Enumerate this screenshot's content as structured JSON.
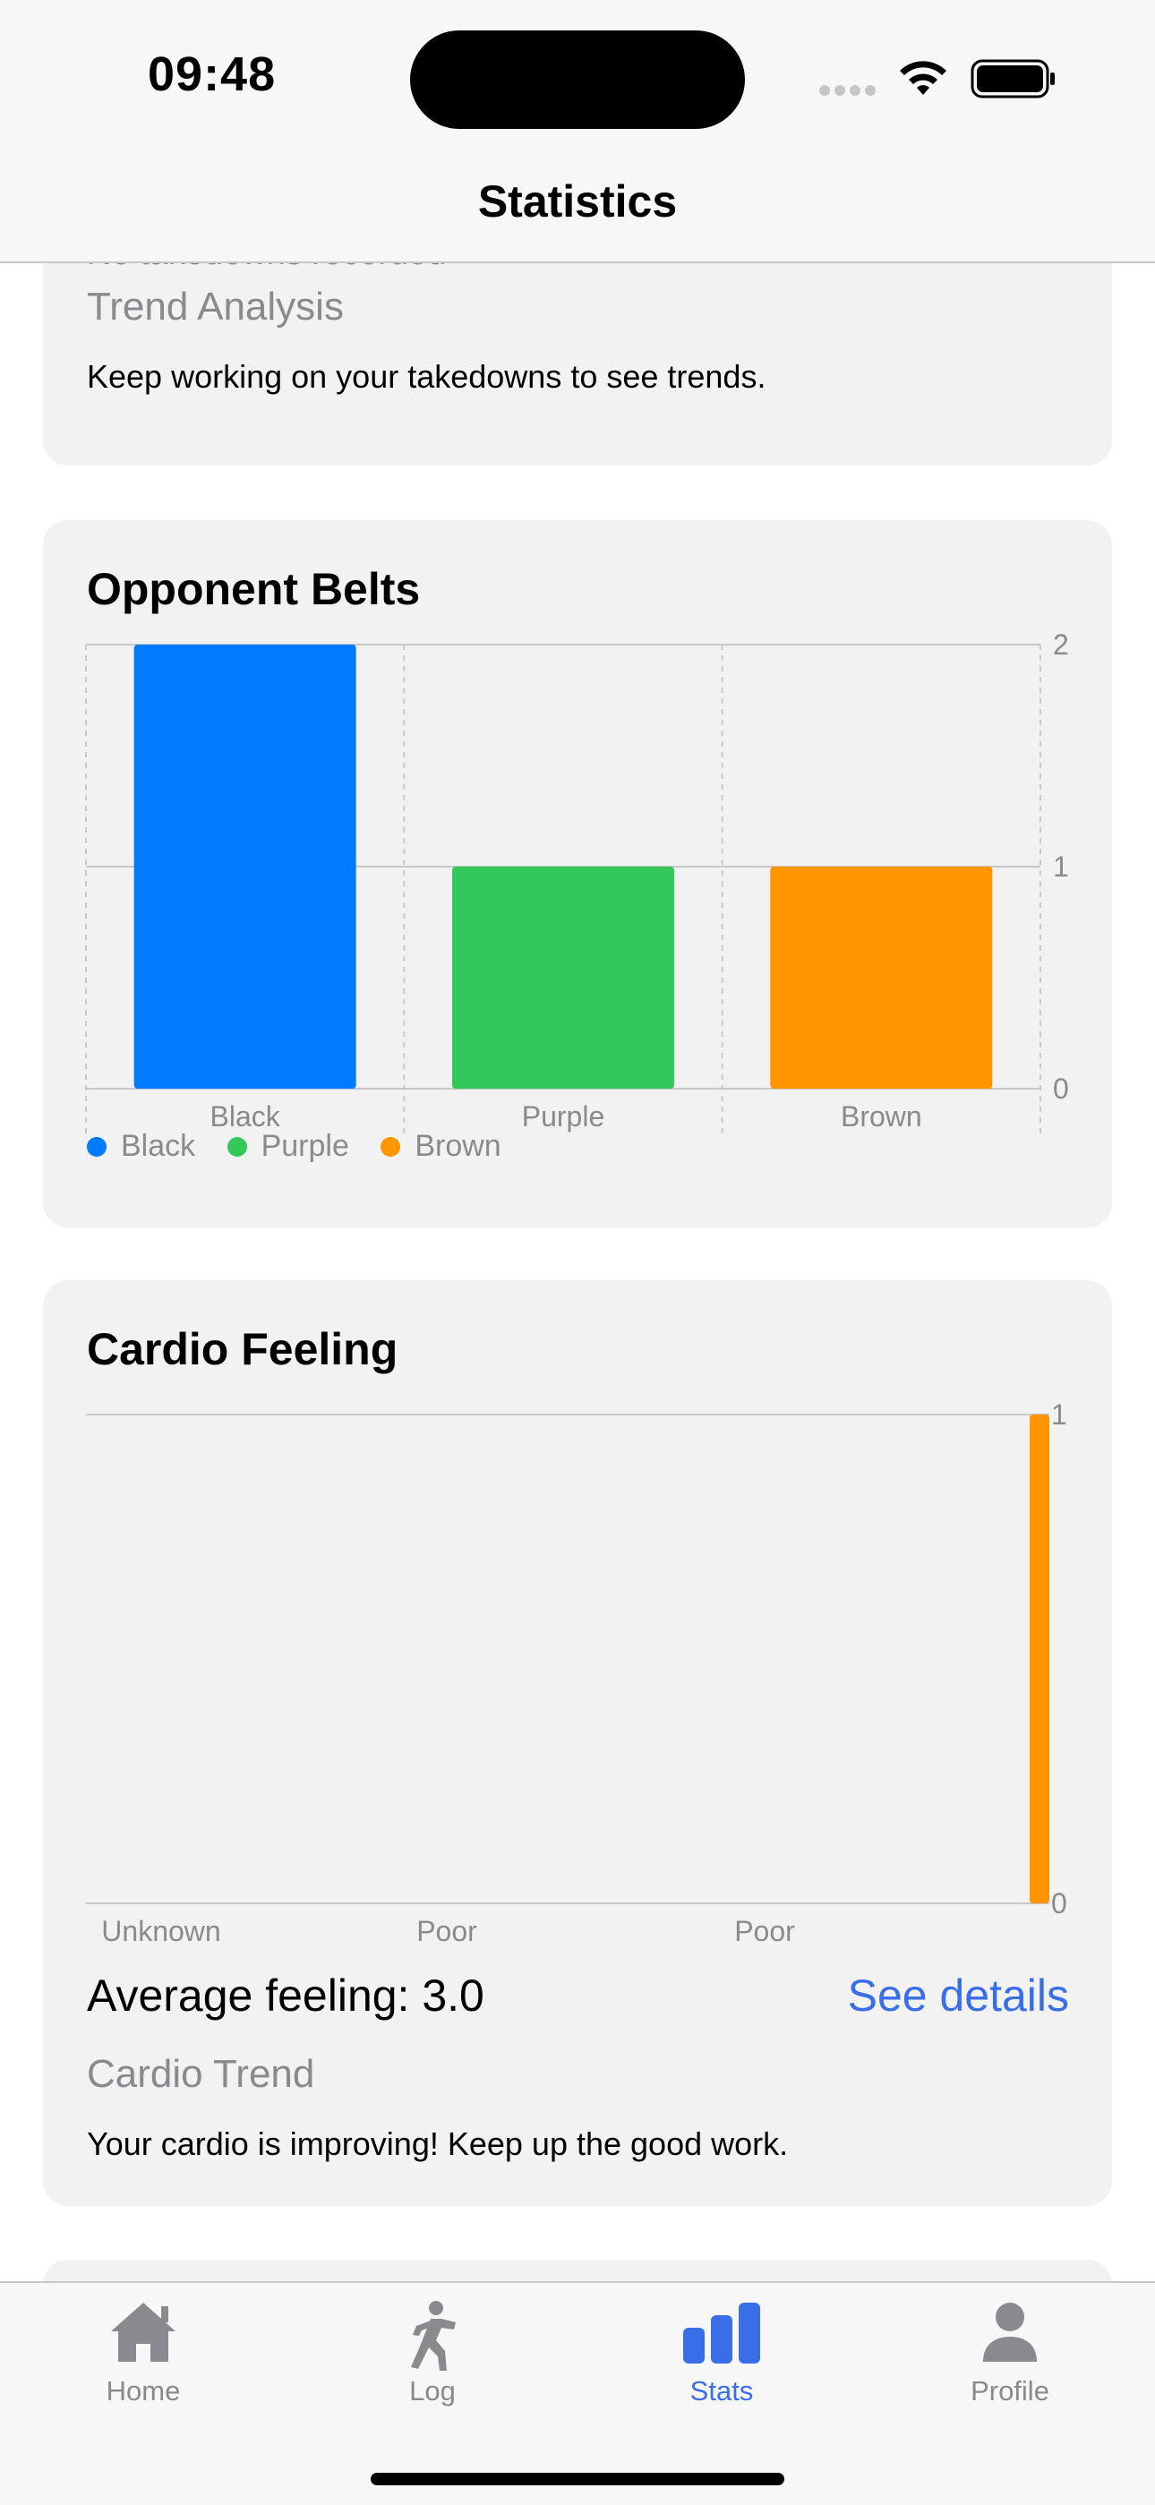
{
  "status_bar": {
    "time": "09:48"
  },
  "nav": {
    "title": "Statistics"
  },
  "takedowns_card": {
    "partial_text": "No takedowns recorded",
    "trend_heading": "Trend Analysis",
    "trend_text": "Keep working on your takedowns to see trends."
  },
  "belts_card": {
    "title": "Opponent Belts",
    "legend": [
      {
        "label": "Black",
        "color": "#007aff"
      },
      {
        "label": "Purple",
        "color": "#34c759"
      },
      {
        "label": "Brown",
        "color": "#ff9500"
      }
    ]
  },
  "cardio_card": {
    "title": "Cardio Feeling",
    "average": "Average feeling: 3.0",
    "see_details": "See details",
    "trend_heading": "Cardio Trend",
    "trend_text": "Your cardio is improving! Keep up the good work."
  },
  "chart_data": [
    {
      "type": "bar",
      "title": "Opponent Belts",
      "categories": [
        "Black",
        "Purple",
        "Brown"
      ],
      "values": [
        2,
        1,
        1
      ],
      "colors": [
        "#007aff",
        "#34c759",
        "#ff9500"
      ],
      "y_ticks": [
        "2",
        "1",
        "0"
      ],
      "ylim": [
        0,
        2
      ],
      "grid": true,
      "legend_position": "bottom-left"
    },
    {
      "type": "bar",
      "title": "Cardio Feeling",
      "x_tick_labels": [
        "Unknown",
        "Poor",
        "Poor"
      ],
      "values": [
        1
      ],
      "colors": [
        "#ff9500"
      ],
      "y_ticks": [
        "1",
        "0"
      ],
      "ylim": [
        0,
        1
      ]
    }
  ],
  "tabs": [
    {
      "label": "Home",
      "icon": "house-icon",
      "active": false
    },
    {
      "label": "Log",
      "icon": "figure-icon",
      "active": false
    },
    {
      "label": "Stats",
      "icon": "chart-bar-icon",
      "active": true
    },
    {
      "label": "Profile",
      "icon": "person-icon",
      "active": false
    }
  ],
  "colors": {
    "accent": "#3a6ee8",
    "card_bg": "#f2f2f2",
    "muted": "#8a8a8e"
  }
}
